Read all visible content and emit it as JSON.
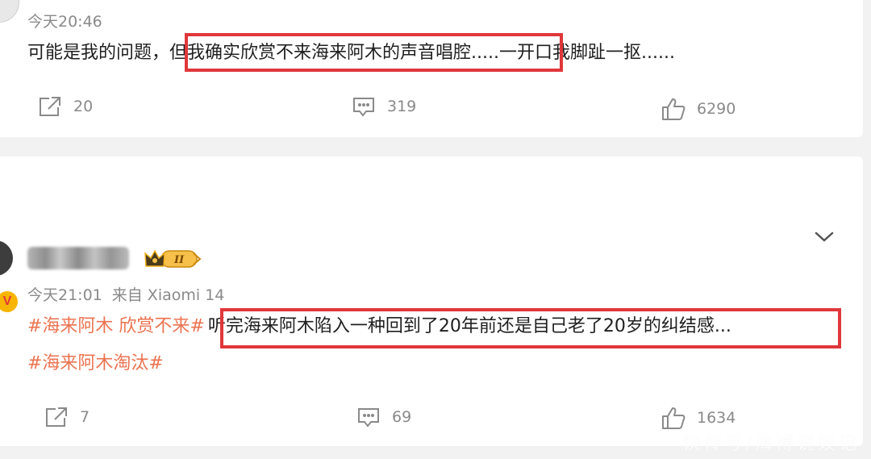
{
  "comment1": {
    "timestamp": "今天20:46",
    "text_before": "可能是我的问题，",
    "text_highlight": "但我确实欣赏不来海来阿木的声音唱腔",
    "text_after": ".....一开口我脚趾一抠......",
    "actions": {
      "share_count": "20",
      "comment_count": "319",
      "like_count": "6290"
    }
  },
  "comment2": {
    "level_badge": "II",
    "timestamp": "今天21:01",
    "source": "来自 Xiaomi 14",
    "verified_badge": "V",
    "topic1": "#海来阿木 欣赏不来#",
    "text_highlight": "听完海来阿木陷入一种回到了20年前还是自己老了20岁的纠结感...",
    "topic2": "#海来阿木淘汰#",
    "actions": {
      "share_count": "7",
      "comment_count": "69",
      "like_count": "1634"
    }
  },
  "watermark": "快传号/海博说娱记",
  "colors": {
    "highlight_border": "#e0373b",
    "topic": "#eb7350",
    "meta": "#8a8a8a"
  },
  "icons": [
    "share-icon",
    "comment-icon",
    "like-icon",
    "chevron-down-icon",
    "crown-icon",
    "verified-icon"
  ]
}
